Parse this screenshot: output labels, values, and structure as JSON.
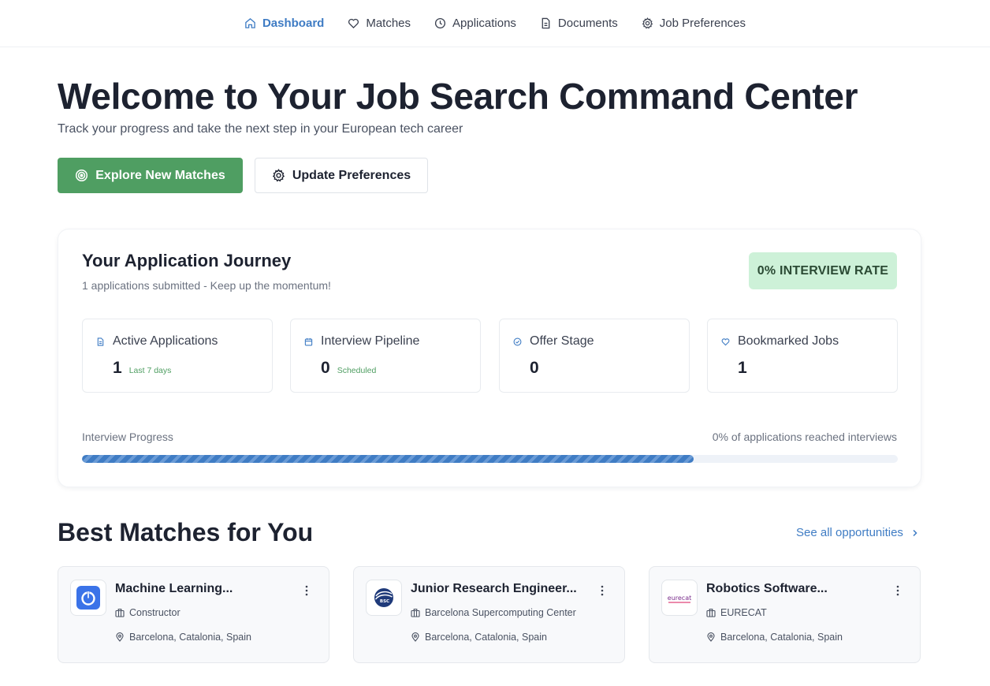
{
  "nav": {
    "items": [
      {
        "label": "Dashboard",
        "icon": "home-icon",
        "active": true
      },
      {
        "label": "Matches",
        "icon": "heart-icon",
        "active": false
      },
      {
        "label": "Applications",
        "icon": "clock-icon",
        "active": false
      },
      {
        "label": "Documents",
        "icon": "document-icon",
        "active": false
      },
      {
        "label": "Job Preferences",
        "icon": "gear-icon",
        "active": false
      }
    ]
  },
  "hero": {
    "title": "Welcome to Your Job Search Command Center",
    "subtitle": "Track your progress and take the next step in your European tech career",
    "primary_button": "Explore New Matches",
    "secondary_button": "Update Preferences"
  },
  "journey": {
    "title": "Your Application Journey",
    "subtitle": "1 applications submitted - Keep up the momentum!",
    "badge": "0% INTERVIEW RATE",
    "stats": [
      {
        "label": "Active Applications",
        "value": "1",
        "tag": "Last 7 days",
        "icon": "document-icon"
      },
      {
        "label": "Interview Pipeline",
        "value": "0",
        "tag": "Scheduled",
        "icon": "calendar-icon"
      },
      {
        "label": "Offer Stage",
        "value": "0",
        "tag": "",
        "icon": "check-circle-icon"
      },
      {
        "label": "Bookmarked Jobs",
        "value": "1",
        "tag": "",
        "icon": "heart-icon"
      }
    ],
    "progress_label": "Interview Progress",
    "progress_text": "0% of applications reached interviews",
    "progress_fill": 0.75
  },
  "matches": {
    "title": "Best Matches for You",
    "see_all": "See all opportunities",
    "jobs": [
      {
        "title": "Machine Learning...",
        "company": "Constructor",
        "location": "Barcelona, Catalonia, Spain",
        "logo": "constructor-logo"
      },
      {
        "title": "Junior Research Engineer...",
        "company": "Barcelona Supercomputing Center",
        "location": "Barcelona, Catalonia, Spain",
        "logo": "bsc-logo",
        "logo_text": "BSC"
      },
      {
        "title": "Robotics Software...",
        "company": "EURECAT",
        "location": "Barcelona, Catalonia, Spain",
        "logo": "eurecat-logo",
        "logo_text": "eurecat"
      }
    ]
  },
  "colors": {
    "accent_blue": "#3f7cc4",
    "primary_green": "#4f9e62",
    "badge_green": "#cdf1d8"
  }
}
